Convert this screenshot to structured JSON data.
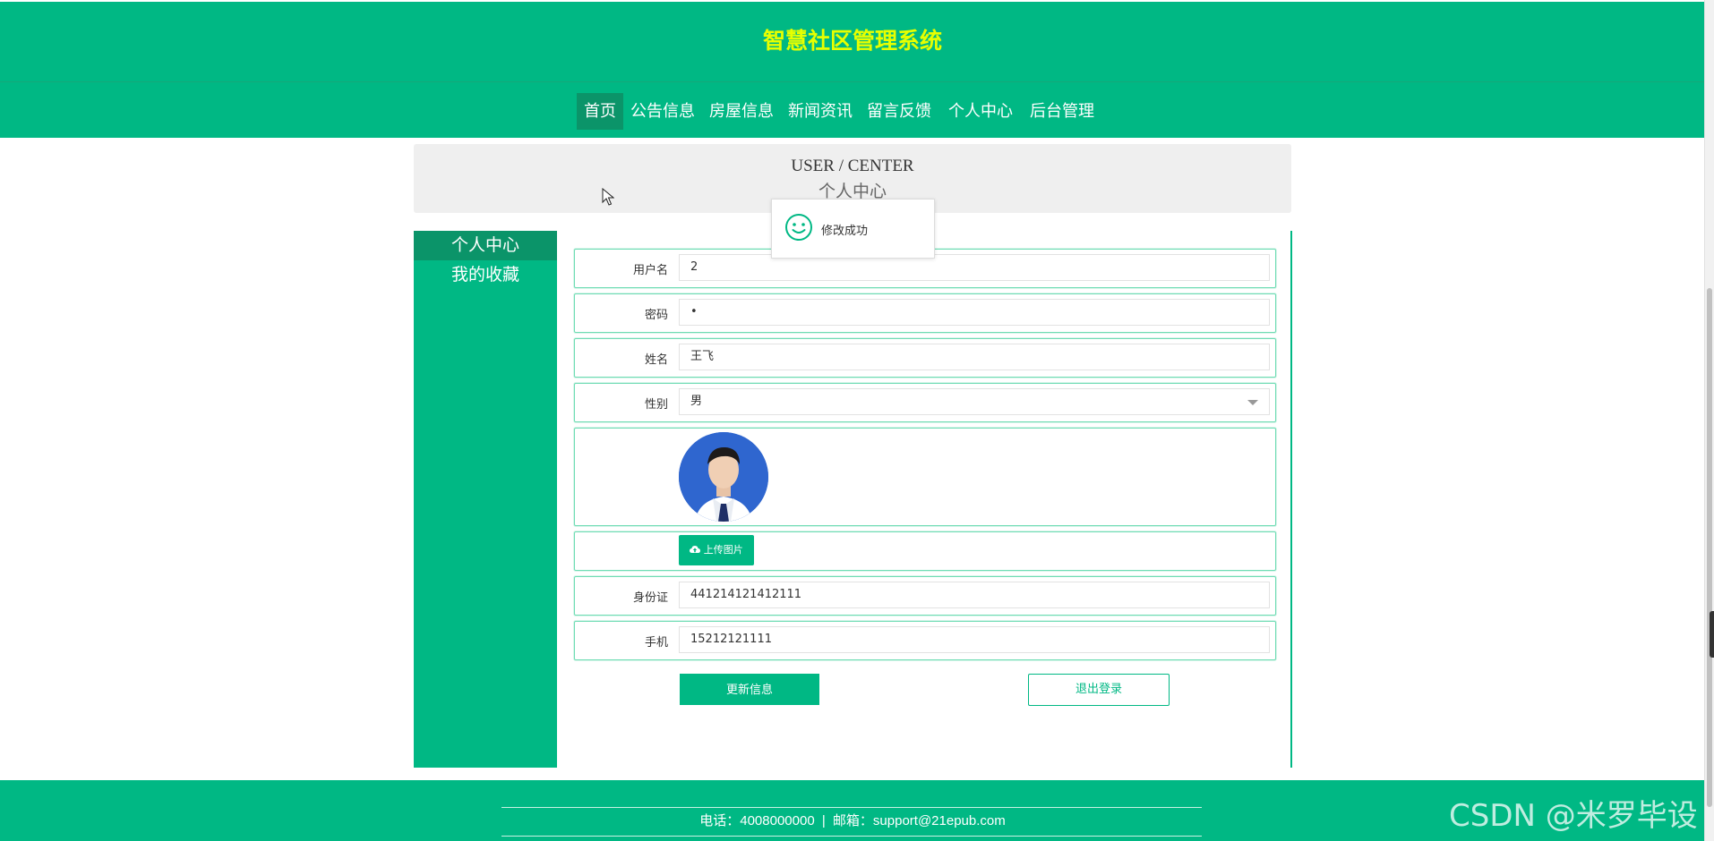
{
  "site": {
    "title": "智慧社区管理系统"
  },
  "nav": {
    "home": "首页",
    "notices": "公告信息",
    "housing": "房屋信息",
    "news": "新闻资讯",
    "feedback": "留言反馈",
    "profile": "个人中心",
    "admin": "后台管理"
  },
  "banner": {
    "en": "USER / CENTER",
    "cn": "个人中心"
  },
  "sidebar": {
    "items": [
      {
        "label": "个人中心"
      },
      {
        "label": "我的收藏"
      }
    ]
  },
  "form": {
    "username": {
      "label": "用户名",
      "value": "2"
    },
    "password": {
      "label": "密码",
      "value": "•"
    },
    "name": {
      "label": "姓名",
      "value": "王飞"
    },
    "gender": {
      "label": "性别",
      "value": "男"
    },
    "upload_label": "上传图片",
    "id_card": {
      "label": "身份证",
      "value": "441214121412111"
    },
    "phone": {
      "label": "手机",
      "value": "15212121111"
    }
  },
  "actions": {
    "update": "更新信息",
    "logout": "退出登录"
  },
  "toast": {
    "message": "修改成功"
  },
  "footer": {
    "phone_label": "电话：4008000000",
    "separator": "|",
    "email_label": "邮箱：support@21epub.com"
  },
  "watermark": "CSDN @米罗毕设",
  "colors": {
    "primary": "#00b884",
    "active": "#0b9469",
    "title": "#e6ff00"
  },
  "icons": [
    "smile-icon",
    "cloud-upload-icon",
    "chevron-down-icon",
    "mouse-pointer-icon"
  ]
}
